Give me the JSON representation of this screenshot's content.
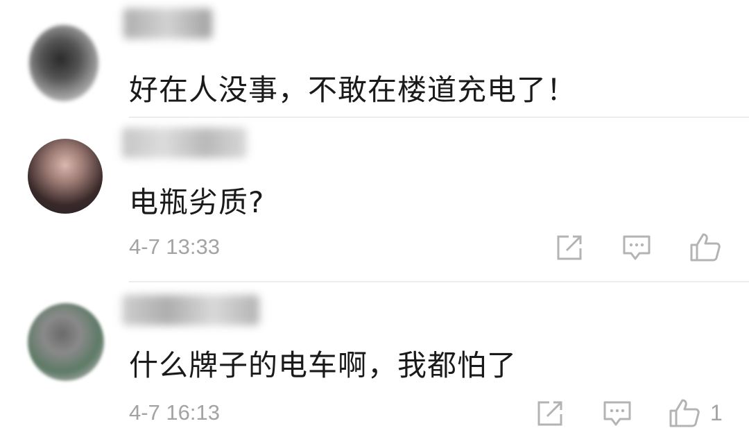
{
  "comments": [
    {
      "text": "好在人没事，不敢在楼道充电了！"
    },
    {
      "text": "电瓶劣质?",
      "time": "4-7 13:33",
      "like_count": ""
    },
    {
      "text": "什么牌子的电车啊，我都怕了",
      "time": "4-7 16:13",
      "like_count": "1"
    }
  ],
  "icons": {
    "share": "share-icon",
    "comment": "comment-icon",
    "like": "thumbs-up-icon"
  },
  "colors": {
    "text": "#1a1a1a",
    "meta": "#a3a3a3",
    "icon": "#b3b3b3",
    "divider": "#ececec"
  }
}
